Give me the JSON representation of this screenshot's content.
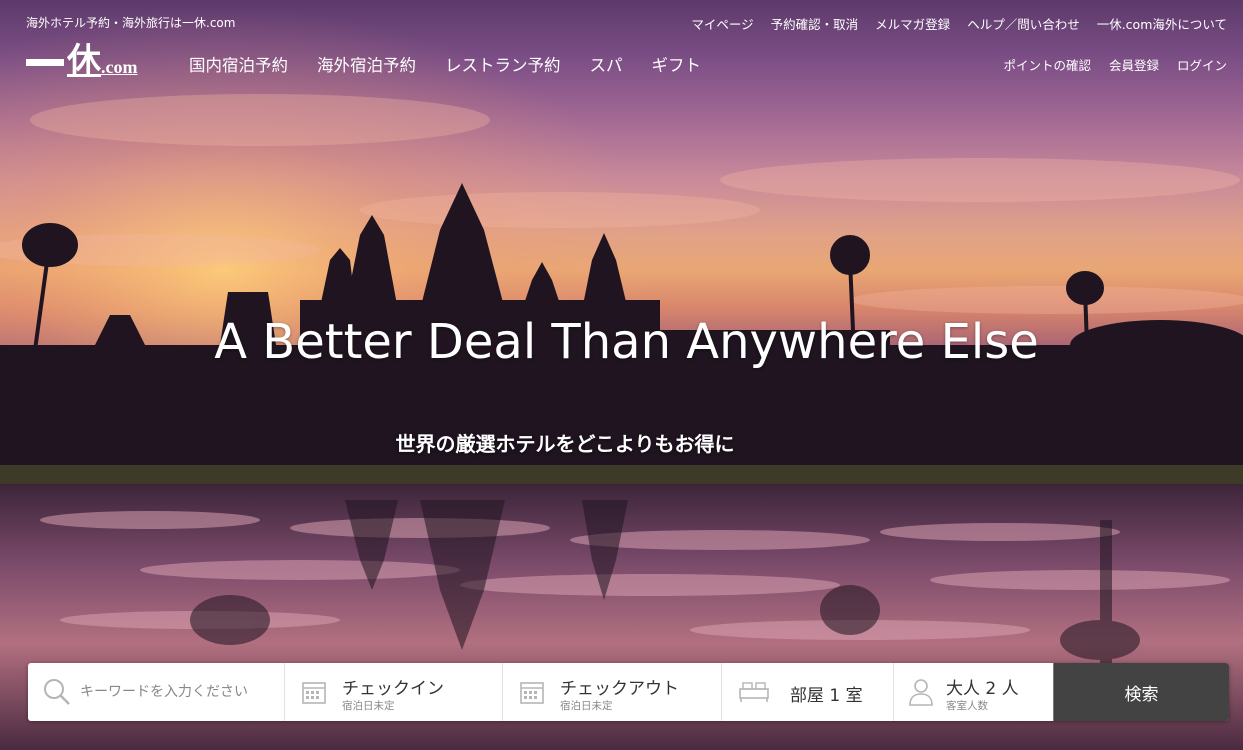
{
  "header": {
    "tagline": "海外ホテル予約・海外旅行は一休.com",
    "top_links": [
      "マイページ",
      "予約確認・取消",
      "メルマガ登録",
      "ヘルプ／問い合わせ",
      "一休.com海外について"
    ],
    "logo": {
      "kanji": "休",
      "suffix": ".com"
    },
    "main_nav": [
      "国内宿泊予約",
      "海外宿泊予約",
      "レストラン予約",
      "スパ",
      "ギフト"
    ],
    "account_links": [
      "ポイントの確認",
      "会員登録",
      "ログイン"
    ]
  },
  "hero": {
    "headline": "A Better Deal Than Anywhere Else",
    "subheadline": "世界の厳選ホテルをどこよりもお得に"
  },
  "search": {
    "keyword_placeholder": "キーワードを入力ください",
    "checkin_label": "チェックイン",
    "checkin_sub": "宿泊日未定",
    "checkout_label": "チェックアウト",
    "checkout_sub": "宿泊日未定",
    "rooms_label": "部屋 1 室",
    "guests_label": "大人 2 人",
    "guests_sub": "客室人数",
    "submit_label": "検索"
  },
  "colors": {
    "search_button": "#434343",
    "text_white": "#ffffff"
  }
}
